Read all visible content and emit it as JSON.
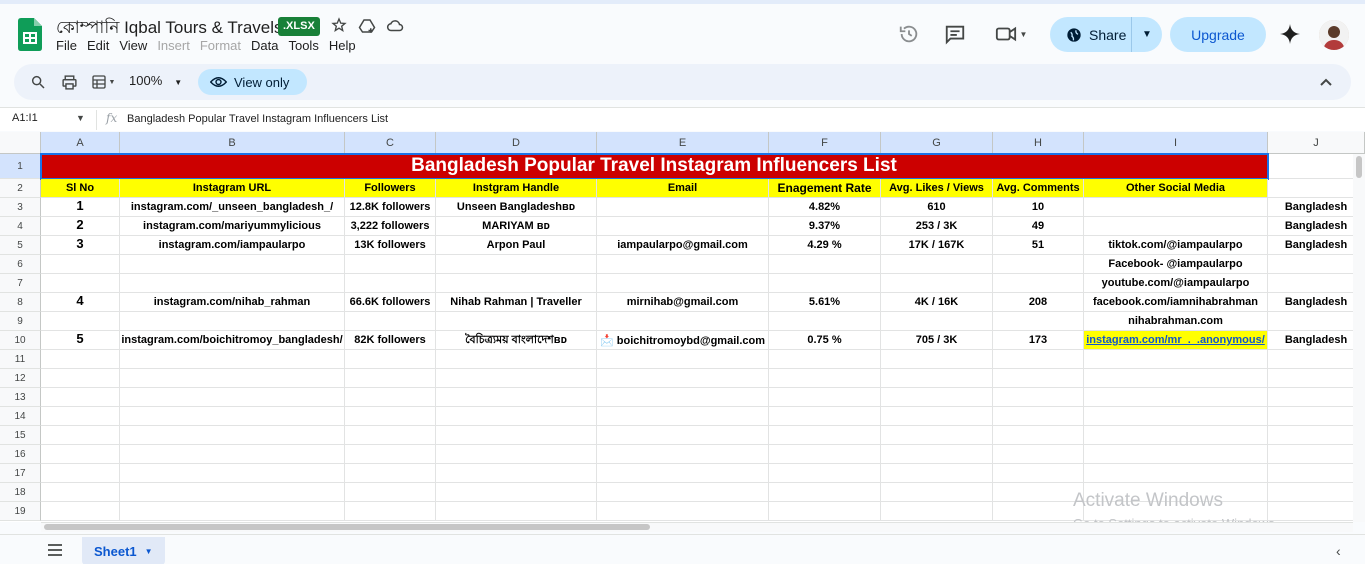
{
  "document": {
    "title": "কোম্পানি Iqbal Tours & Travels",
    "badge": ".XLSX"
  },
  "menu": [
    "File",
    "Edit",
    "View",
    "Insert",
    "Format",
    "Data",
    "Tools",
    "Help"
  ],
  "menu_disabled": [
    "Insert",
    "Format"
  ],
  "header_actions": {
    "share_label": "Share",
    "upgrade_label": "Upgrade"
  },
  "toolbar": {
    "zoom": "100%",
    "view_only_label": "View only"
  },
  "formula_bar": {
    "cell_ref": "A1:I1",
    "content": "Bangladesh Popular Travel Instagram Influencers List"
  },
  "columns": [
    "A",
    "B",
    "C",
    "D",
    "E",
    "F",
    "G",
    "H",
    "I",
    "J"
  ],
  "rows": [
    "1",
    "2",
    "3",
    "4",
    "5",
    "6",
    "7",
    "8",
    "9",
    "10",
    "11",
    "12",
    "13",
    "14",
    "15",
    "16",
    "17",
    "18",
    "19"
  ],
  "sheet": {
    "title": "Bangladesh Popular Travel Instagram Influencers List",
    "headers": [
      "Sl No",
      "Instagram URL",
      "Followers",
      "Instgram Handle",
      "Email",
      "Enagement Rate",
      "Avg. Likes / Views",
      "Avg. Comments",
      "Other Social Media"
    ],
    "records": [
      {
        "row": 3,
        "cells": [
          "1",
          "instagram.com/_unseen_bangladesh_/",
          "12.8K followers",
          "Unseen Bangladeshʙᴅ",
          "",
          "4.82%",
          "610",
          "10",
          "",
          "Bangladesh"
        ]
      },
      {
        "row": 4,
        "cells": [
          "2",
          "instagram.com/mariyummylicious",
          "3,222 followers",
          "MARIYAM ʙᴅ",
          "",
          "9.37%",
          "253 / 3K",
          "49",
          "",
          "Bangladesh"
        ]
      },
      {
        "row": 5,
        "cells": [
          "3",
          "instagram.com/iampaularpo",
          "13K followers",
          "Arpon Paul",
          "iampaularpo@gmail.com",
          "4.29 %",
          "17K / 167K",
          "51",
          "tiktok.com/@iampaularpo",
          "Bangladesh"
        ]
      },
      {
        "row": 6,
        "cells": [
          "",
          "",
          "",
          "",
          "",
          "",
          "",
          "",
          "Facebook- @iampaularpo",
          ""
        ]
      },
      {
        "row": 7,
        "cells": [
          "",
          "",
          "",
          "",
          "",
          "",
          "",
          "",
          "youtube.com/@iampaularpo",
          ""
        ]
      },
      {
        "row": 8,
        "cells": [
          "4",
          "instagram.com/nihab_rahman",
          "66.6K followers",
          "Nihab Rahman | Traveller",
          "mirnihab@gmail.com",
          "5.61%",
          "4K / 16K",
          "208",
          "facebook.com/iamnihabrahman",
          "Bangladesh"
        ]
      },
      {
        "row": 9,
        "cells": [
          "",
          "",
          "",
          "",
          "",
          "",
          "",
          "",
          "nihabrahman.com",
          ""
        ]
      },
      {
        "row": 10,
        "cells": [
          "5",
          "instagram.com/boichitromoy_bangladesh/",
          "82K followers",
          "বৈচিত্র্যময় বাংলাদেশʙᴅ",
          "📩 boichitromoybd@gmail.com",
          "0.75 %",
          "705 / 3K",
          "173",
          "instagram.com/mr_._.anonymous/",
          "Bangladesh"
        ]
      }
    ]
  },
  "highlighted_cells": [
    {
      "row": 10,
      "col": "I",
      "color": "#ffff00"
    }
  ],
  "colors": {
    "title_bg": "#cc0000",
    "header_bg": "#ffff00",
    "accent": "#0b57d0",
    "button_bg": "#c2e7ff"
  },
  "watermark": {
    "line1": "Activate Windows",
    "line2": "Go to Settings to activate Windows."
  },
  "bottom": {
    "sheet_tab": "Sheet1"
  }
}
